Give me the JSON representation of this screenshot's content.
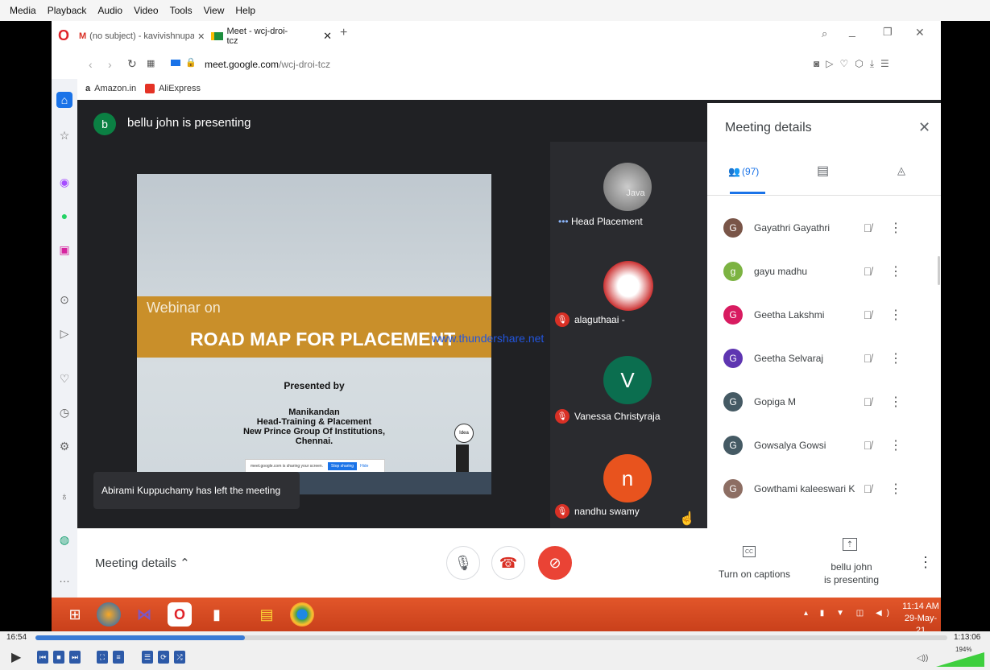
{
  "vlc_menu": [
    "Media",
    "Playback",
    "Audio",
    "Video",
    "Tools",
    "View",
    "Help"
  ],
  "tabs": [
    {
      "label": "(no subject) - kavivishnupa",
      "icon": "gmail-icon"
    },
    {
      "label": "Meet - wcj-droi-tcz",
      "icon": "meet-icon"
    }
  ],
  "address": {
    "domain": "meet.google.com",
    "path": "/wcj-droi-tcz"
  },
  "bookmarks": [
    "Amazon.in",
    "AliExpress"
  ],
  "presenting_banner": {
    "avatar": "b",
    "text": "bellu john is presenting"
  },
  "slide": {
    "line1": "Webinar on",
    "line2": "ROAD MAP FOR PLACEMENT",
    "presented_by": "Presented by",
    "name": "Manikandan",
    "role": "Head-Training & Placement",
    "org": "New Prince Group Of Institutions,",
    "city": "Chennai.",
    "share_notice": "meet.google.com is sharing your screen.",
    "stop_sharing": "Stop sharing",
    "hide": "Hide",
    "idea": "Idea"
  },
  "watermark": "www.thundershare.net",
  "toast": "Abirami Kuppuchamy has left the meeting",
  "tiles": [
    {
      "name": "Head Placement",
      "label": "Java",
      "muted": false
    },
    {
      "name": "alaguthaai -",
      "muted": true
    },
    {
      "name": "Vanessa Christyraja",
      "initial": "V",
      "muted": true
    },
    {
      "name": "nandhu swamy",
      "initial": "n",
      "muted": true
    }
  ],
  "panel": {
    "title": "Meeting details",
    "people_count": "(97)",
    "participants": [
      {
        "initial": "G",
        "name": "Gayathri Gayathri",
        "color": "#795548"
      },
      {
        "initial": "g",
        "name": "gayu madhu",
        "color": "#7cb342"
      },
      {
        "initial": "G",
        "name": "Geetha Lakshmi",
        "color": "#d81b60"
      },
      {
        "initial": "G",
        "name": "Geetha Selvaraj",
        "color": "#5e35b1"
      },
      {
        "initial": "G",
        "name": "Gopiga M",
        "color": "#455a64"
      },
      {
        "initial": "G",
        "name": "Gowsalya Gowsi",
        "color": "#455a64"
      },
      {
        "initial": "G",
        "name": "Gowthami kaleeswari K",
        "color": "#8d6e63"
      }
    ]
  },
  "bottom": {
    "meeting_details": "Meeting details",
    "captions": "Turn on captions",
    "presenting_line1": "bellu john",
    "presenting_line2": "is presenting",
    "cc": "CC"
  },
  "taskbar": {
    "time": "11:14 AM",
    "date": "29-May-21"
  },
  "vlc": {
    "elapsed": "16:54",
    "total": "1:13:06",
    "volume": "194%",
    "progress": 0.23
  }
}
